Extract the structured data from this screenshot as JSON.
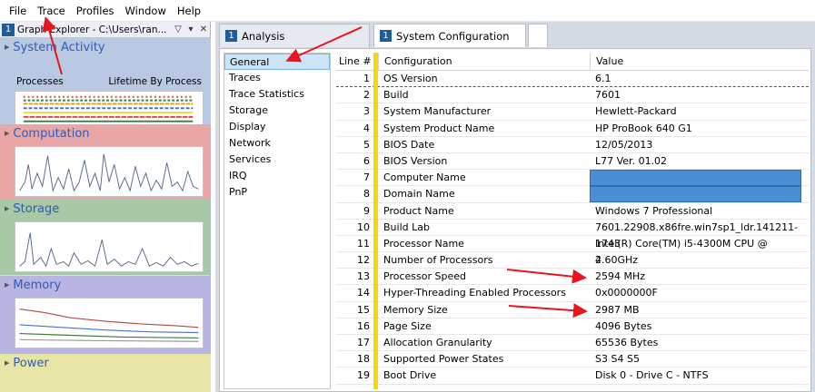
{
  "menu": [
    "File",
    "Trace",
    "Profiles",
    "Window",
    "Help"
  ],
  "graph_explorer": {
    "number": "1",
    "title": "Graph Explorer - C:\\Users\\ran...",
    "sections": {
      "system_activity": {
        "label": "System Activity",
        "sub_left": "Processes",
        "sub_right": "Lifetime By Process"
      },
      "computation": {
        "label": "Computation"
      },
      "storage": {
        "label": "Storage"
      },
      "memory": {
        "label": "Memory"
      },
      "power": {
        "label": "Power"
      }
    }
  },
  "tabs": [
    {
      "number": "1",
      "label": "Analysis"
    },
    {
      "number": "1",
      "label": "System Configuration"
    }
  ],
  "nav": {
    "items": [
      "General",
      "Traces",
      "Trace Statistics",
      "Storage",
      "Display",
      "Network",
      "Services",
      "IRQ",
      "PnP"
    ],
    "selected": "General"
  },
  "grid": {
    "headers": {
      "line": "Line #",
      "configuration": "Configuration",
      "value": "Value"
    },
    "rows": [
      {
        "line": "1",
        "configuration": "OS Version",
        "value": "6.1"
      },
      {
        "line": "2",
        "configuration": "Build",
        "value": "7601"
      },
      {
        "line": "3",
        "configuration": "System Manufacturer",
        "value": "Hewlett-Packard"
      },
      {
        "line": "4",
        "configuration": "System Product Name",
        "value": "HP ProBook 640 G1"
      },
      {
        "line": "5",
        "configuration": "BIOS Date",
        "value": "12/05/2013"
      },
      {
        "line": "6",
        "configuration": "BIOS Version",
        "value": "L77 Ver. 01.02"
      },
      {
        "line": "7",
        "configuration": "Computer Name",
        "value": ""
      },
      {
        "line": "8",
        "configuration": "Domain Name",
        "value": ""
      },
      {
        "line": "9",
        "configuration": "Product Name",
        "value": "Windows 7 Professional"
      },
      {
        "line": "10",
        "configuration": "Build Lab",
        "value": "7601.22908.x86fre.win7sp1_ldr.141211-1743"
      },
      {
        "line": "11",
        "configuration": "Processor Name",
        "value": "Intel(R) Core(TM) i5-4300M CPU @ 2.60GHz"
      },
      {
        "line": "12",
        "configuration": "Number of Processors",
        "value": "4"
      },
      {
        "line": "13",
        "configuration": "Processor Speed",
        "value": "2594 MHz"
      },
      {
        "line": "14",
        "configuration": "Hyper-Threading Enabled Processors",
        "value": "0x0000000F"
      },
      {
        "line": "15",
        "configuration": "Memory Size",
        "value": "2987 MB"
      },
      {
        "line": "16",
        "configuration": "Page Size",
        "value": "4096 Bytes"
      },
      {
        "line": "17",
        "configuration": "Allocation Granularity",
        "value": "65536 Bytes"
      },
      {
        "line": "18",
        "configuration": "Supported Power States",
        "value": "S3 S4 S5"
      },
      {
        "line": "19",
        "configuration": "Boot Drive",
        "value": "Disk 0 - Drive C - NTFS"
      }
    ]
  },
  "colors": {
    "annotation_arrow": "#e8141e",
    "redaction": "#4a8fd4",
    "line_marker": "#f5d80a",
    "selection": "#cce4f7"
  }
}
